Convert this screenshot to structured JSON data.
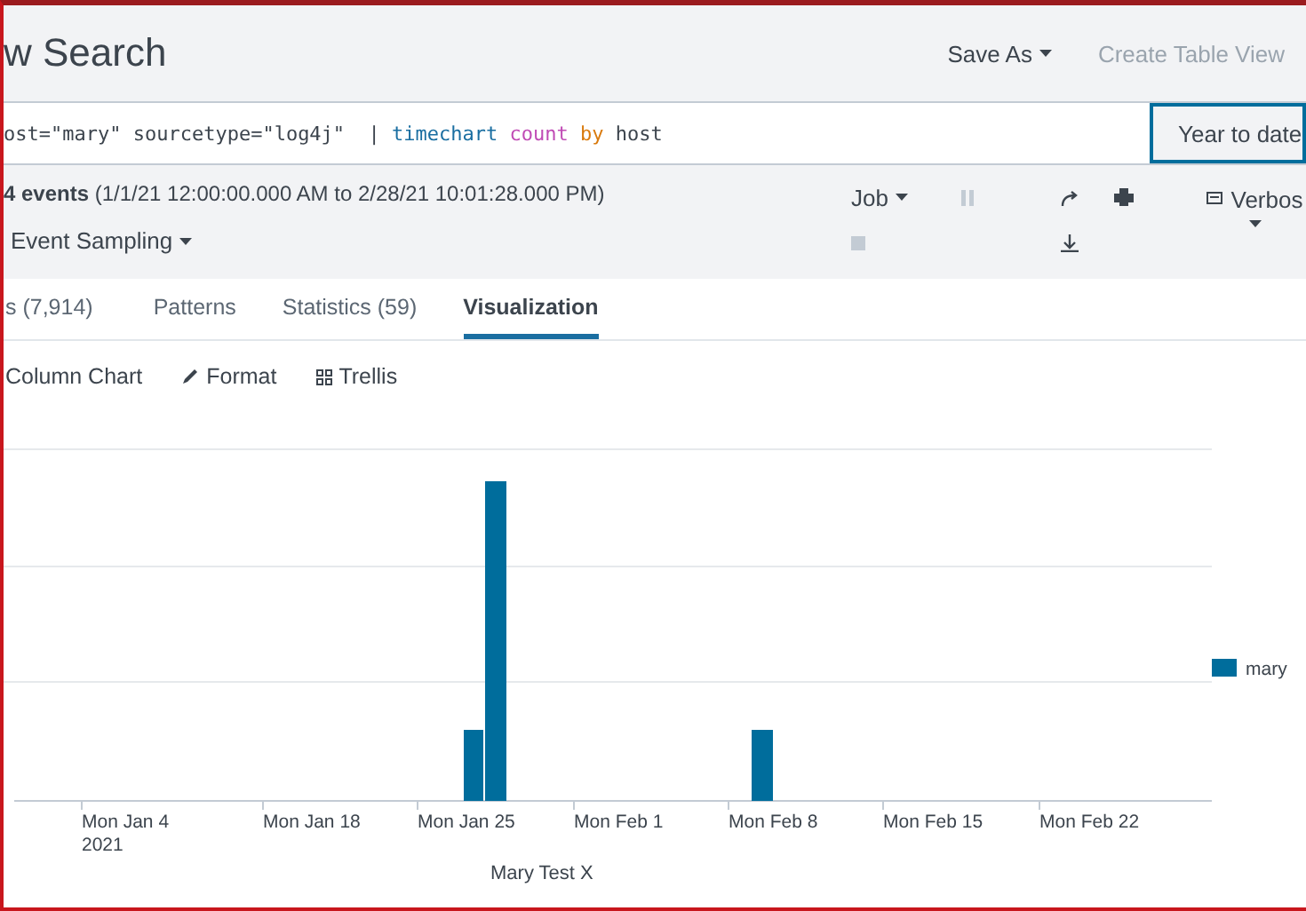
{
  "header": {
    "title": "w Search",
    "save_as": "Save As",
    "create_table_view": "Create Table View"
  },
  "search": {
    "tokens": [
      {
        "kind": "plain",
        "text": "ost=\"mary\" sourcetype=\"log4j\"  | "
      },
      {
        "kind": "command",
        "text": "timechart"
      },
      {
        "kind": "function",
        "text": " count"
      },
      {
        "kind": "keyword",
        "text": " by"
      },
      {
        "kind": "plain",
        "text": " host"
      }
    ],
    "time_range": "Year to date"
  },
  "job_bar": {
    "summary": "**4 events** (1/1/21 12:00:00.000 AM to 2/28/21 10:01:28.000 PM)",
    "sampling": "Event Sampling",
    "job": "Job",
    "mode": "Verbos"
  },
  "tabs": [
    {
      "label": "s (7,914)",
      "selected": false
    },
    {
      "label": "Patterns",
      "selected": false
    },
    {
      "label": "Statistics (59)",
      "selected": false
    },
    {
      "label": "Visualization",
      "selected": true
    }
  ],
  "viz_toolbar": [
    {
      "kind": "chart",
      "label": "Column Chart"
    },
    {
      "kind": "format",
      "label": "Format"
    },
    {
      "kind": "trellis",
      "label": "Trellis"
    }
  ],
  "chart": {
    "x_labels": [
      [
        "Mon Jan 4",
        "2021"
      ],
      [
        "Mon Jan 18"
      ],
      [
        "Mon Jan 25"
      ],
      [
        "Mon Feb 1"
      ],
      [
        "Mon Feb 8"
      ],
      [
        "Mon Feb 15"
      ],
      [
        "Mon Feb 22"
      ]
    ],
    "x_title": "Mary Test X",
    "legend": [
      {
        "name": "mary",
        "color": "#006d9c"
      }
    ]
  }
}
